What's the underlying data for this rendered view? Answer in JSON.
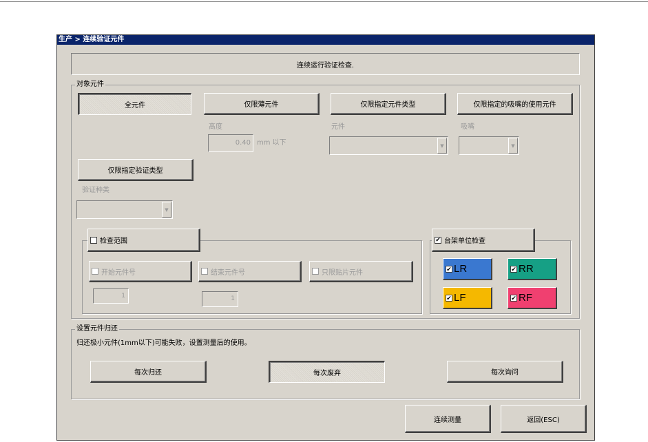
{
  "window": {
    "title": "生产 > 连续验证元件"
  },
  "info_text": "连续运行验证检查.",
  "target_group": {
    "label": "对象元件",
    "buttons": {
      "all": "全元件",
      "thin": "仅限薄元件",
      "type": "仅限指定元件类型",
      "nozzle": "仅限指定的吸嘴的使用元件",
      "verify_type": "仅限指定验证类型"
    },
    "height_label": "高度",
    "height_value": "0.40",
    "height_unit": "mm 以下",
    "part_label": "元件",
    "part_value": "",
    "nozzle_label": "吸嘴",
    "nozzle_value": "",
    "verify_kind_label": "验证种类",
    "verify_kind_value": ""
  },
  "range": {
    "title": "检查范围",
    "checked": false,
    "start_label": "开始元件号",
    "start_value": "1",
    "end_label": "结束元件号",
    "end_value": "1",
    "patch_label": "只限贴片元件"
  },
  "rack": {
    "title": "台架单位检查",
    "checked": true,
    "check_mark": "✔",
    "tiles": [
      {
        "label": "LR",
        "color": "#3a78d0",
        "checked": true
      },
      {
        "label": "RR",
        "color": "#16a085",
        "checked": true
      },
      {
        "label": "LF",
        "color": "#f5b800",
        "checked": true
      },
      {
        "label": "RF",
        "color": "#f04070",
        "checked": true
      }
    ]
  },
  "return_group": {
    "label": "设置元件归还",
    "note": "归还极小元件(1mm以下)可能失败，设置测量后的使用。",
    "every_return": "每次归还",
    "every_discard": "每次废弃",
    "every_ask": "每次询问"
  },
  "footer": {
    "continuous_measure": "连续测量",
    "back": "返回(ESC)"
  },
  "icons": {
    "dropdown": "chevron-down-icon",
    "checkbox": "checkbox-icon"
  }
}
